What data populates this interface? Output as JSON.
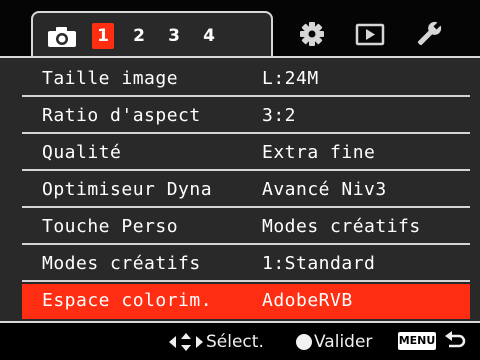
{
  "tabs": {
    "camera_icon": "camera-icon",
    "pages": [
      "1",
      "2",
      "3",
      "4"
    ],
    "selected_page": "1",
    "other_tabs": [
      "gear-icon",
      "playback-icon",
      "wrench-icon"
    ]
  },
  "menu": {
    "items": [
      {
        "label": "Taille image",
        "value": "L:24M"
      },
      {
        "label": "Ratio d'aspect",
        "value": "3:2"
      },
      {
        "label": "Qualité",
        "value": "Extra fine"
      },
      {
        "label": "Optimiseur Dyna",
        "value": "Avancé Niv3"
      },
      {
        "label": "Touche Perso",
        "value": "Modes créatifs"
      },
      {
        "label": "Modes créatifs",
        "value": "1:Standard"
      },
      {
        "label": "Espace colorim.",
        "value": "AdobeRVB"
      }
    ],
    "selected_index": 6
  },
  "footer": {
    "select_hint": "Sélect.",
    "confirm_hint": "Valider",
    "menu_badge": "MENU"
  },
  "colors": {
    "accent": "#ff2d12",
    "panel": "#292929",
    "divider": "#d4d4d4",
    "background": "#050505"
  }
}
